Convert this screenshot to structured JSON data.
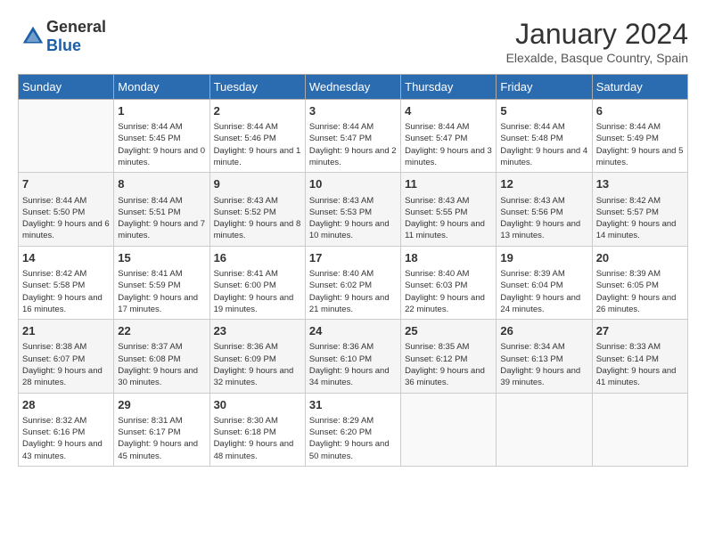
{
  "header": {
    "logo_general": "General",
    "logo_blue": "Blue",
    "month": "January 2024",
    "location": "Elexalde, Basque Country, Spain"
  },
  "days_of_week": [
    "Sunday",
    "Monday",
    "Tuesday",
    "Wednesday",
    "Thursday",
    "Friday",
    "Saturday"
  ],
  "weeks": [
    [
      {
        "day": "",
        "sunrise": "",
        "sunset": "",
        "daylight": ""
      },
      {
        "day": "1",
        "sunrise": "Sunrise: 8:44 AM",
        "sunset": "Sunset: 5:45 PM",
        "daylight": "Daylight: 9 hours and 0 minutes."
      },
      {
        "day": "2",
        "sunrise": "Sunrise: 8:44 AM",
        "sunset": "Sunset: 5:46 PM",
        "daylight": "Daylight: 9 hours and 1 minute."
      },
      {
        "day": "3",
        "sunrise": "Sunrise: 8:44 AM",
        "sunset": "Sunset: 5:47 PM",
        "daylight": "Daylight: 9 hours and 2 minutes."
      },
      {
        "day": "4",
        "sunrise": "Sunrise: 8:44 AM",
        "sunset": "Sunset: 5:47 PM",
        "daylight": "Daylight: 9 hours and 3 minutes."
      },
      {
        "day": "5",
        "sunrise": "Sunrise: 8:44 AM",
        "sunset": "Sunset: 5:48 PM",
        "daylight": "Daylight: 9 hours and 4 minutes."
      },
      {
        "day": "6",
        "sunrise": "Sunrise: 8:44 AM",
        "sunset": "Sunset: 5:49 PM",
        "daylight": "Daylight: 9 hours and 5 minutes."
      }
    ],
    [
      {
        "day": "7",
        "sunrise": "Sunrise: 8:44 AM",
        "sunset": "Sunset: 5:50 PM",
        "daylight": "Daylight: 9 hours and 6 minutes."
      },
      {
        "day": "8",
        "sunrise": "Sunrise: 8:44 AM",
        "sunset": "Sunset: 5:51 PM",
        "daylight": "Daylight: 9 hours and 7 minutes."
      },
      {
        "day": "9",
        "sunrise": "Sunrise: 8:43 AM",
        "sunset": "Sunset: 5:52 PM",
        "daylight": "Daylight: 9 hours and 8 minutes."
      },
      {
        "day": "10",
        "sunrise": "Sunrise: 8:43 AM",
        "sunset": "Sunset: 5:53 PM",
        "daylight": "Daylight: 9 hours and 10 minutes."
      },
      {
        "day": "11",
        "sunrise": "Sunrise: 8:43 AM",
        "sunset": "Sunset: 5:55 PM",
        "daylight": "Daylight: 9 hours and 11 minutes."
      },
      {
        "day": "12",
        "sunrise": "Sunrise: 8:43 AM",
        "sunset": "Sunset: 5:56 PM",
        "daylight": "Daylight: 9 hours and 13 minutes."
      },
      {
        "day": "13",
        "sunrise": "Sunrise: 8:42 AM",
        "sunset": "Sunset: 5:57 PM",
        "daylight": "Daylight: 9 hours and 14 minutes."
      }
    ],
    [
      {
        "day": "14",
        "sunrise": "Sunrise: 8:42 AM",
        "sunset": "Sunset: 5:58 PM",
        "daylight": "Daylight: 9 hours and 16 minutes."
      },
      {
        "day": "15",
        "sunrise": "Sunrise: 8:41 AM",
        "sunset": "Sunset: 5:59 PM",
        "daylight": "Daylight: 9 hours and 17 minutes."
      },
      {
        "day": "16",
        "sunrise": "Sunrise: 8:41 AM",
        "sunset": "Sunset: 6:00 PM",
        "daylight": "Daylight: 9 hours and 19 minutes."
      },
      {
        "day": "17",
        "sunrise": "Sunrise: 8:40 AM",
        "sunset": "Sunset: 6:02 PM",
        "daylight": "Daylight: 9 hours and 21 minutes."
      },
      {
        "day": "18",
        "sunrise": "Sunrise: 8:40 AM",
        "sunset": "Sunset: 6:03 PM",
        "daylight": "Daylight: 9 hours and 22 minutes."
      },
      {
        "day": "19",
        "sunrise": "Sunrise: 8:39 AM",
        "sunset": "Sunset: 6:04 PM",
        "daylight": "Daylight: 9 hours and 24 minutes."
      },
      {
        "day": "20",
        "sunrise": "Sunrise: 8:39 AM",
        "sunset": "Sunset: 6:05 PM",
        "daylight": "Daylight: 9 hours and 26 minutes."
      }
    ],
    [
      {
        "day": "21",
        "sunrise": "Sunrise: 8:38 AM",
        "sunset": "Sunset: 6:07 PM",
        "daylight": "Daylight: 9 hours and 28 minutes."
      },
      {
        "day": "22",
        "sunrise": "Sunrise: 8:37 AM",
        "sunset": "Sunset: 6:08 PM",
        "daylight": "Daylight: 9 hours and 30 minutes."
      },
      {
        "day": "23",
        "sunrise": "Sunrise: 8:36 AM",
        "sunset": "Sunset: 6:09 PM",
        "daylight": "Daylight: 9 hours and 32 minutes."
      },
      {
        "day": "24",
        "sunrise": "Sunrise: 8:36 AM",
        "sunset": "Sunset: 6:10 PM",
        "daylight": "Daylight: 9 hours and 34 minutes."
      },
      {
        "day": "25",
        "sunrise": "Sunrise: 8:35 AM",
        "sunset": "Sunset: 6:12 PM",
        "daylight": "Daylight: 9 hours and 36 minutes."
      },
      {
        "day": "26",
        "sunrise": "Sunrise: 8:34 AM",
        "sunset": "Sunset: 6:13 PM",
        "daylight": "Daylight: 9 hours and 39 minutes."
      },
      {
        "day": "27",
        "sunrise": "Sunrise: 8:33 AM",
        "sunset": "Sunset: 6:14 PM",
        "daylight": "Daylight: 9 hours and 41 minutes."
      }
    ],
    [
      {
        "day": "28",
        "sunrise": "Sunrise: 8:32 AM",
        "sunset": "Sunset: 6:16 PM",
        "daylight": "Daylight: 9 hours and 43 minutes."
      },
      {
        "day": "29",
        "sunrise": "Sunrise: 8:31 AM",
        "sunset": "Sunset: 6:17 PM",
        "daylight": "Daylight: 9 hours and 45 minutes."
      },
      {
        "day": "30",
        "sunrise": "Sunrise: 8:30 AM",
        "sunset": "Sunset: 6:18 PM",
        "daylight": "Daylight: 9 hours and 48 minutes."
      },
      {
        "day": "31",
        "sunrise": "Sunrise: 8:29 AM",
        "sunset": "Sunset: 6:20 PM",
        "daylight": "Daylight: 9 hours and 50 minutes."
      },
      {
        "day": "",
        "sunrise": "",
        "sunset": "",
        "daylight": ""
      },
      {
        "day": "",
        "sunrise": "",
        "sunset": "",
        "daylight": ""
      },
      {
        "day": "",
        "sunrise": "",
        "sunset": "",
        "daylight": ""
      }
    ]
  ]
}
